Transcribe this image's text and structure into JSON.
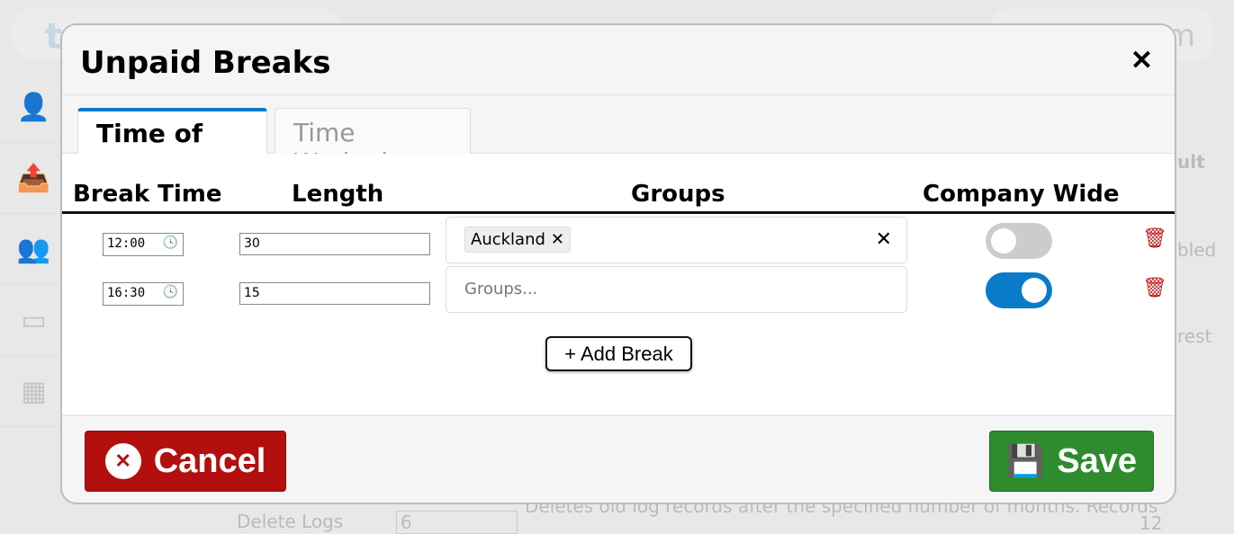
{
  "background": {
    "logo": "timeclock",
    "search_fragment": "m",
    "col_fragment": "ult",
    "row1_fragment": "bled",
    "row2_fragment": "rest",
    "delete_logs_label": "Delete Logs",
    "delete_logs_value": "6",
    "delete_logs_desc": "Deletes old log records after the specified number of months. Records",
    "delete_logs_default": "12"
  },
  "modal": {
    "title": "Unpaid Breaks",
    "tabs": [
      {
        "label": "Time of Day",
        "active": true
      },
      {
        "label": "Time Worked",
        "active": false
      }
    ],
    "columns": [
      "Break Time",
      "Length",
      "Groups",
      "Company Wide"
    ],
    "breaks": [
      {
        "time": "12:00",
        "length": "30",
        "groups": [
          "Auckland"
        ],
        "company_wide": false
      },
      {
        "time": "16:30",
        "length": "15",
        "groups": [],
        "company_wide": true
      }
    ],
    "groups_placeholder": "Groups...",
    "add_break_label": "+ Add Break",
    "cancel_label": "Cancel",
    "save_label": "Save"
  },
  "colors": {
    "accent": "#0a7bc8",
    "cancel": "#b30f0f",
    "save": "#2e8b2e",
    "toggle_off": "#cccccc",
    "delete": "#c21818"
  }
}
